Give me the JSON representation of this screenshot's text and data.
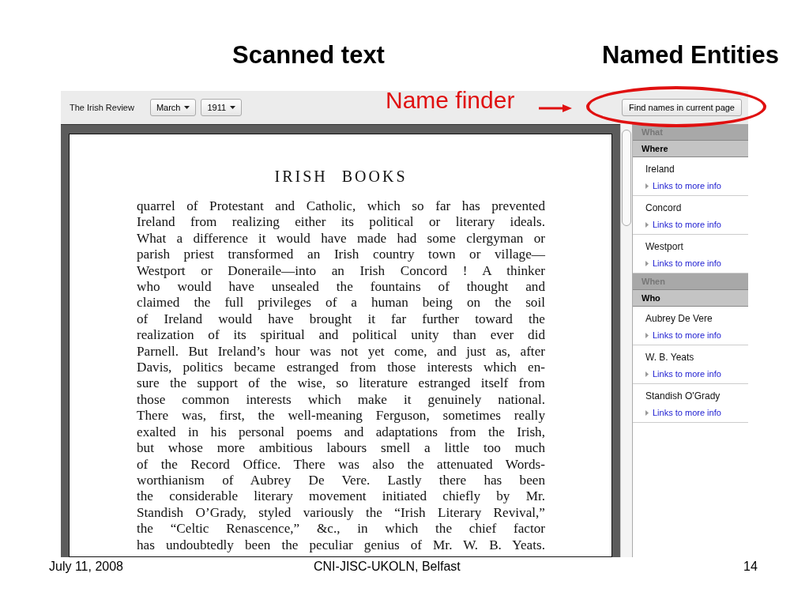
{
  "headings": [
    "Scanned text",
    "Named Entities"
  ],
  "annotation": {
    "label": "Name finder"
  },
  "toolbar": {
    "title": "The Irish Review",
    "dropdowns": [
      "March",
      "1911"
    ],
    "button": "Find names in current page"
  },
  "page": {
    "title": "IRISH BOOKS",
    "lines": [
      "quarrel of Protestant and Catholic, which so far has prevented",
      "Ireland from realizing either its political or literary ideals.",
      "What a difference it would have made had some clergyman or",
      "parish priest transformed an Irish country town or village—",
      "Westport or Doneraile—into an Irish Concord ! A thinker",
      "who would have unsealed the fountains of thought and",
      "claimed the full privileges of a human being on the soil",
      "of Ireland would have brought it far further toward the",
      "realization of its spiritual and political unity than ever did",
      "Parnell. But Ireland’s hour was not yet come, and just as, after",
      "Davis, politics became estranged from those interests which en-",
      "sure the support of the wise, so literature estranged itself from",
      "those common interests which make it genuinely national.",
      "There was, first, the well-meaning Ferguson, sometimes really",
      "exalted in his personal poems and adaptations from the Irish,",
      "but whose more ambitious labours smell a little too much",
      "of the Record Office. There was also the attenuated Words-",
      "worthianism of Aubrey De Vere. Lastly there has been",
      "the considerable literary movement initiated chiefly by Mr.",
      "Standish O’Grady, styled variously the “Irish Literary Revival,”",
      "the “Celtic Renascence,” &c., in which the chief factor",
      "has undoubtedly been the peculiar genius of Mr. W. B. Yeats."
    ]
  },
  "sidebar": {
    "sections": [
      {
        "label": "What",
        "expanded": false
      },
      {
        "label": "Where",
        "expanded": true,
        "items": [
          {
            "name": "Ireland",
            "link": "Links to more info"
          },
          {
            "name": "Concord",
            "link": "Links to more info"
          },
          {
            "name": "Westport",
            "link": "Links to more info"
          }
        ]
      },
      {
        "label": "When",
        "expanded": false
      },
      {
        "label": "Who",
        "expanded": true,
        "items": [
          {
            "name": "Aubrey De Vere",
            "link": "Links to more info"
          },
          {
            "name": "W. B. Yeats",
            "link": "Links to more info"
          },
          {
            "name": "Standish O'Grady",
            "link": "Links to more info"
          }
        ]
      }
    ]
  },
  "footer": {
    "date": "July 11, 2008",
    "venue": "CNI-JISC-UKOLN, Belfast",
    "page_number": "14"
  }
}
